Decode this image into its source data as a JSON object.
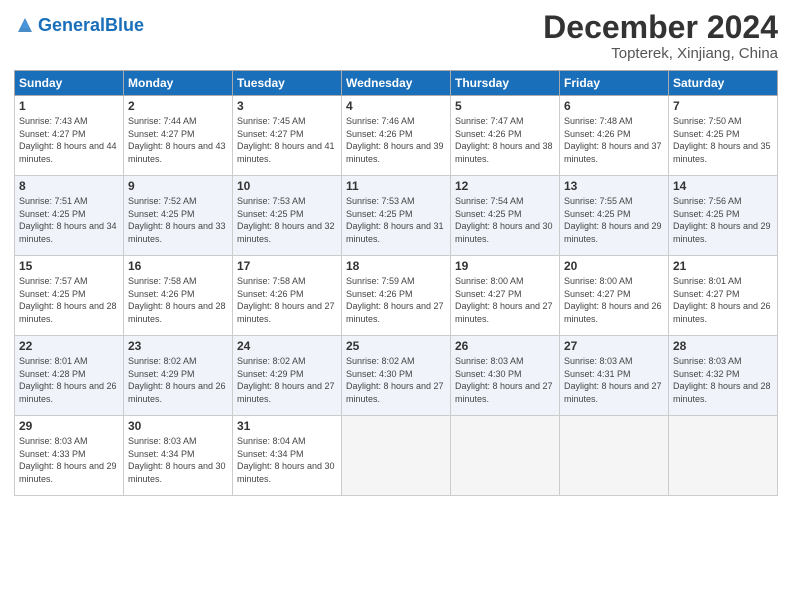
{
  "logo": {
    "text_general": "General",
    "text_blue": "Blue"
  },
  "header": {
    "month": "December 2024",
    "location": "Topterek, Xinjiang, China"
  },
  "weekdays": [
    "Sunday",
    "Monday",
    "Tuesday",
    "Wednesday",
    "Thursday",
    "Friday",
    "Saturday"
  ],
  "weeks": [
    [
      {
        "day": "1",
        "sunrise": "7:43 AM",
        "sunset": "4:27 PM",
        "daylight": "8 hours and 44 minutes."
      },
      {
        "day": "2",
        "sunrise": "7:44 AM",
        "sunset": "4:27 PM",
        "daylight": "8 hours and 43 minutes."
      },
      {
        "day": "3",
        "sunrise": "7:45 AM",
        "sunset": "4:27 PM",
        "daylight": "8 hours and 41 minutes."
      },
      {
        "day": "4",
        "sunrise": "7:46 AM",
        "sunset": "4:26 PM",
        "daylight": "8 hours and 39 minutes."
      },
      {
        "day": "5",
        "sunrise": "7:47 AM",
        "sunset": "4:26 PM",
        "daylight": "8 hours and 38 minutes."
      },
      {
        "day": "6",
        "sunrise": "7:48 AM",
        "sunset": "4:26 PM",
        "daylight": "8 hours and 37 minutes."
      },
      {
        "day": "7",
        "sunrise": "7:50 AM",
        "sunset": "4:25 PM",
        "daylight": "8 hours and 35 minutes."
      }
    ],
    [
      {
        "day": "8",
        "sunrise": "7:51 AM",
        "sunset": "4:25 PM",
        "daylight": "8 hours and 34 minutes."
      },
      {
        "day": "9",
        "sunrise": "7:52 AM",
        "sunset": "4:25 PM",
        "daylight": "8 hours and 33 minutes."
      },
      {
        "day": "10",
        "sunrise": "7:53 AM",
        "sunset": "4:25 PM",
        "daylight": "8 hours and 32 minutes."
      },
      {
        "day": "11",
        "sunrise": "7:53 AM",
        "sunset": "4:25 PM",
        "daylight": "8 hours and 31 minutes."
      },
      {
        "day": "12",
        "sunrise": "7:54 AM",
        "sunset": "4:25 PM",
        "daylight": "8 hours and 30 minutes."
      },
      {
        "day": "13",
        "sunrise": "7:55 AM",
        "sunset": "4:25 PM",
        "daylight": "8 hours and 29 minutes."
      },
      {
        "day": "14",
        "sunrise": "7:56 AM",
        "sunset": "4:25 PM",
        "daylight": "8 hours and 29 minutes."
      }
    ],
    [
      {
        "day": "15",
        "sunrise": "7:57 AM",
        "sunset": "4:25 PM",
        "daylight": "8 hours and 28 minutes."
      },
      {
        "day": "16",
        "sunrise": "7:58 AM",
        "sunset": "4:26 PM",
        "daylight": "8 hours and 28 minutes."
      },
      {
        "day": "17",
        "sunrise": "7:58 AM",
        "sunset": "4:26 PM",
        "daylight": "8 hours and 27 minutes."
      },
      {
        "day": "18",
        "sunrise": "7:59 AM",
        "sunset": "4:26 PM",
        "daylight": "8 hours and 27 minutes."
      },
      {
        "day": "19",
        "sunrise": "8:00 AM",
        "sunset": "4:27 PM",
        "daylight": "8 hours and 27 minutes."
      },
      {
        "day": "20",
        "sunrise": "8:00 AM",
        "sunset": "4:27 PM",
        "daylight": "8 hours and 26 minutes."
      },
      {
        "day": "21",
        "sunrise": "8:01 AM",
        "sunset": "4:27 PM",
        "daylight": "8 hours and 26 minutes."
      }
    ],
    [
      {
        "day": "22",
        "sunrise": "8:01 AM",
        "sunset": "4:28 PM",
        "daylight": "8 hours and 26 minutes."
      },
      {
        "day": "23",
        "sunrise": "8:02 AM",
        "sunset": "4:29 PM",
        "daylight": "8 hours and 26 minutes."
      },
      {
        "day": "24",
        "sunrise": "8:02 AM",
        "sunset": "4:29 PM",
        "daylight": "8 hours and 27 minutes."
      },
      {
        "day": "25",
        "sunrise": "8:02 AM",
        "sunset": "4:30 PM",
        "daylight": "8 hours and 27 minutes."
      },
      {
        "day": "26",
        "sunrise": "8:03 AM",
        "sunset": "4:30 PM",
        "daylight": "8 hours and 27 minutes."
      },
      {
        "day": "27",
        "sunrise": "8:03 AM",
        "sunset": "4:31 PM",
        "daylight": "8 hours and 27 minutes."
      },
      {
        "day": "28",
        "sunrise": "8:03 AM",
        "sunset": "4:32 PM",
        "daylight": "8 hours and 28 minutes."
      }
    ],
    [
      {
        "day": "29",
        "sunrise": "8:03 AM",
        "sunset": "4:33 PM",
        "daylight": "8 hours and 29 minutes."
      },
      {
        "day": "30",
        "sunrise": "8:03 AM",
        "sunset": "4:34 PM",
        "daylight": "8 hours and 30 minutes."
      },
      {
        "day": "31",
        "sunrise": "8:04 AM",
        "sunset": "4:34 PM",
        "daylight": "8 hours and 30 minutes."
      },
      null,
      null,
      null,
      null
    ]
  ]
}
